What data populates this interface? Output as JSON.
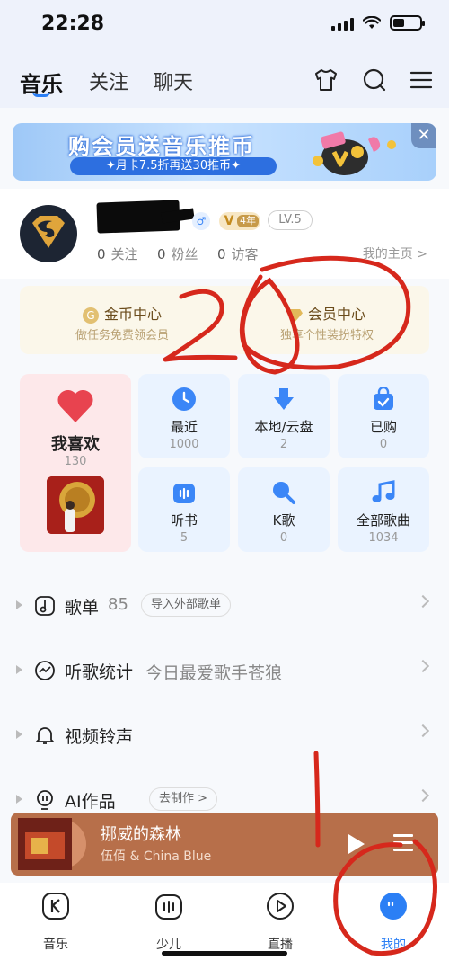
{
  "status_bar": {
    "time": "22:28"
  },
  "top_nav": {
    "tabs": [
      {
        "label": "音乐",
        "active": true
      },
      {
        "label": "关注",
        "active": false
      },
      {
        "label": "聊天",
        "active": false
      }
    ],
    "icons": [
      "tshirt-icon",
      "search-icon",
      "menu-icon"
    ]
  },
  "banner": {
    "title": "购会员送音乐推币",
    "subtitle": "✦月卡7.5折再送30推币✦"
  },
  "profile": {
    "vip_badge": "4年",
    "level": "LV.5",
    "stats": [
      {
        "value": "0",
        "label": "关注"
      },
      {
        "value": "0",
        "label": "粉丝"
      },
      {
        "value": "0",
        "label": "访客"
      }
    ],
    "homepage_label": "我的主页 >"
  },
  "centers": [
    {
      "title": "金币中心",
      "subtitle": "做任务免费领会员",
      "coin": "G"
    },
    {
      "title": "会员中心",
      "subtitle": "独享个性装扮特权"
    }
  ],
  "favorites": {
    "title": "我喜欢",
    "count": "130"
  },
  "tiles": [
    {
      "label": "最近",
      "count": "1000",
      "icon": "clock-icon"
    },
    {
      "label": "本地/云盘",
      "count": "2",
      "icon": "download-icon"
    },
    {
      "label": "已购",
      "count": "0",
      "icon": "bag-icon"
    },
    {
      "label": "听书",
      "count": "5",
      "icon": "radio-icon"
    },
    {
      "label": "K歌",
      "count": "0",
      "icon": "mic-icon"
    },
    {
      "label": "全部歌曲",
      "count": "1034",
      "icon": "music-note-icon"
    }
  ],
  "rows": [
    {
      "label": "歌单",
      "extra": "85",
      "pill": "导入外部歌单"
    },
    {
      "label": "听歌统计",
      "extra": "今日最爱歌手苍狼"
    },
    {
      "label": "视频铃声"
    },
    {
      "label": "AI作品",
      "pill": "去制作 >"
    }
  ],
  "player": {
    "title": "挪威的森林",
    "artist": "伍佰 & China Blue"
  },
  "tabbar": [
    {
      "label": "音乐",
      "icon": "k-icon"
    },
    {
      "label": "少儿",
      "icon": "kids-icon"
    },
    {
      "label": "直播",
      "icon": "live-icon"
    },
    {
      "label": "我的",
      "icon": "profile-icon",
      "active": true
    }
  ],
  "colors": {
    "accent": "#2b7ff5",
    "annotation": "#d6281c",
    "player_bg": "#b76f4a"
  }
}
